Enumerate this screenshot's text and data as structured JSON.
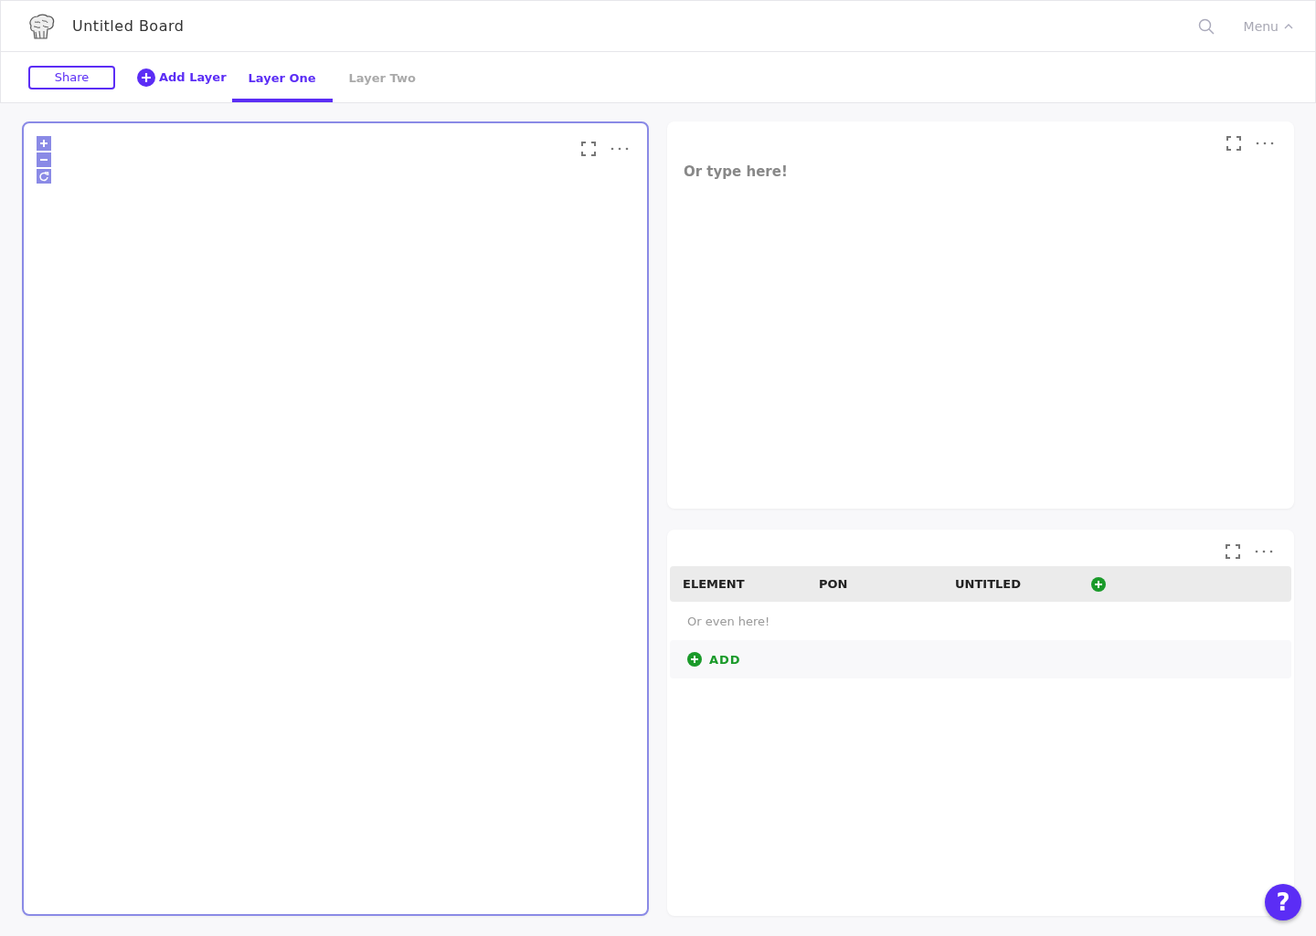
{
  "header": {
    "title": "Untitled Board",
    "menu": "Menu"
  },
  "toolbar": {
    "share": "Share",
    "add_layer": "Add Layer",
    "tabs": [
      {
        "label": "Layer One",
        "selected": true
      },
      {
        "label": "Layer Two",
        "selected": false
      }
    ]
  },
  "panels": [
    {
      "kind": "canvas",
      "selected": true
    },
    {
      "kind": "text",
      "selected": false,
      "placeholder": "Or type here!"
    },
    {
      "kind": "table",
      "selected": false,
      "columns": [
        "ELEMENT",
        "PON",
        "UNTITLED"
      ],
      "rows": [
        {
          "placeholder": "Or even here!"
        }
      ],
      "add": "ADD"
    }
  ],
  "help": "?"
}
